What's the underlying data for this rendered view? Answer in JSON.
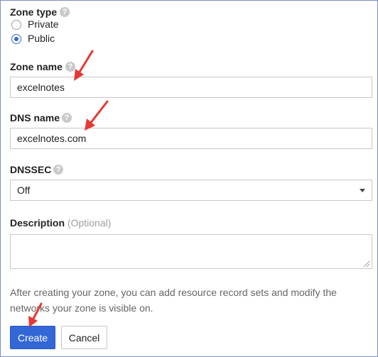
{
  "zone_type": {
    "label": "Zone type",
    "help_icon": "?",
    "options": [
      {
        "label": "Private",
        "checked": false
      },
      {
        "label": "Public",
        "checked": true
      }
    ]
  },
  "zone_name": {
    "label": "Zone name",
    "help_icon": "?",
    "value": "excelnotes"
  },
  "dns_name": {
    "label": "DNS name",
    "help_icon": "?",
    "value": "excelnotes.com"
  },
  "dnssec": {
    "label": "DNSSEC",
    "help_icon": "?",
    "selected": "Off"
  },
  "description": {
    "label": "Description",
    "optional": "(Optional)",
    "value": ""
  },
  "info_text": "After creating your zone, you can add resource record sets and modify the networks your zone is visible on.",
  "buttons": {
    "create": "Create",
    "cancel": "Cancel"
  },
  "colors": {
    "accent": "#3367d6",
    "annotation_arrow": "#e53935"
  }
}
